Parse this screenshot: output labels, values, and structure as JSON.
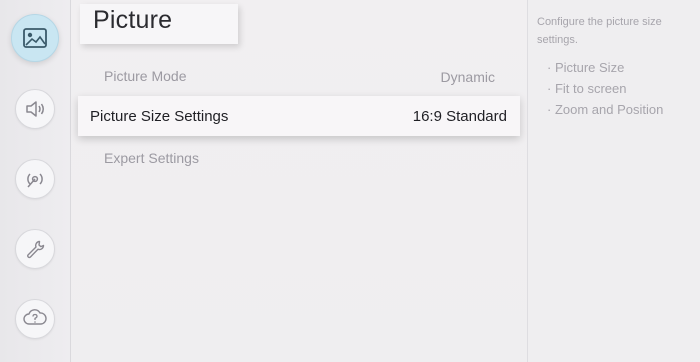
{
  "sidebar": {
    "items": [
      {
        "icon": "picture-icon",
        "active": true
      },
      {
        "icon": "sound-icon",
        "active": false
      },
      {
        "icon": "broadcasting-icon",
        "active": false
      },
      {
        "icon": "general-icon",
        "active": false
      },
      {
        "icon": "support-icon",
        "active": false
      }
    ]
  },
  "header": {
    "title": "Picture"
  },
  "menu": {
    "items": [
      {
        "label": "Picture Mode",
        "value": "Dynamic"
      },
      {
        "label": "Picture Size Settings",
        "value": "16:9 Standard",
        "focused": true
      },
      {
        "label": "Expert Settings",
        "value": ""
      }
    ]
  },
  "help": {
    "description": "Configure the picture size settings.",
    "options": [
      "· Picture Size",
      "· Fit to screen",
      "· Zoom and Position"
    ]
  },
  "colors": {
    "background": "#ecebee",
    "active_icon_bg": "#c9e6f2",
    "focus_bg": "#f8f6f8",
    "text_dark": "#1f1f24",
    "text_muted": "#9c9aa2"
  }
}
